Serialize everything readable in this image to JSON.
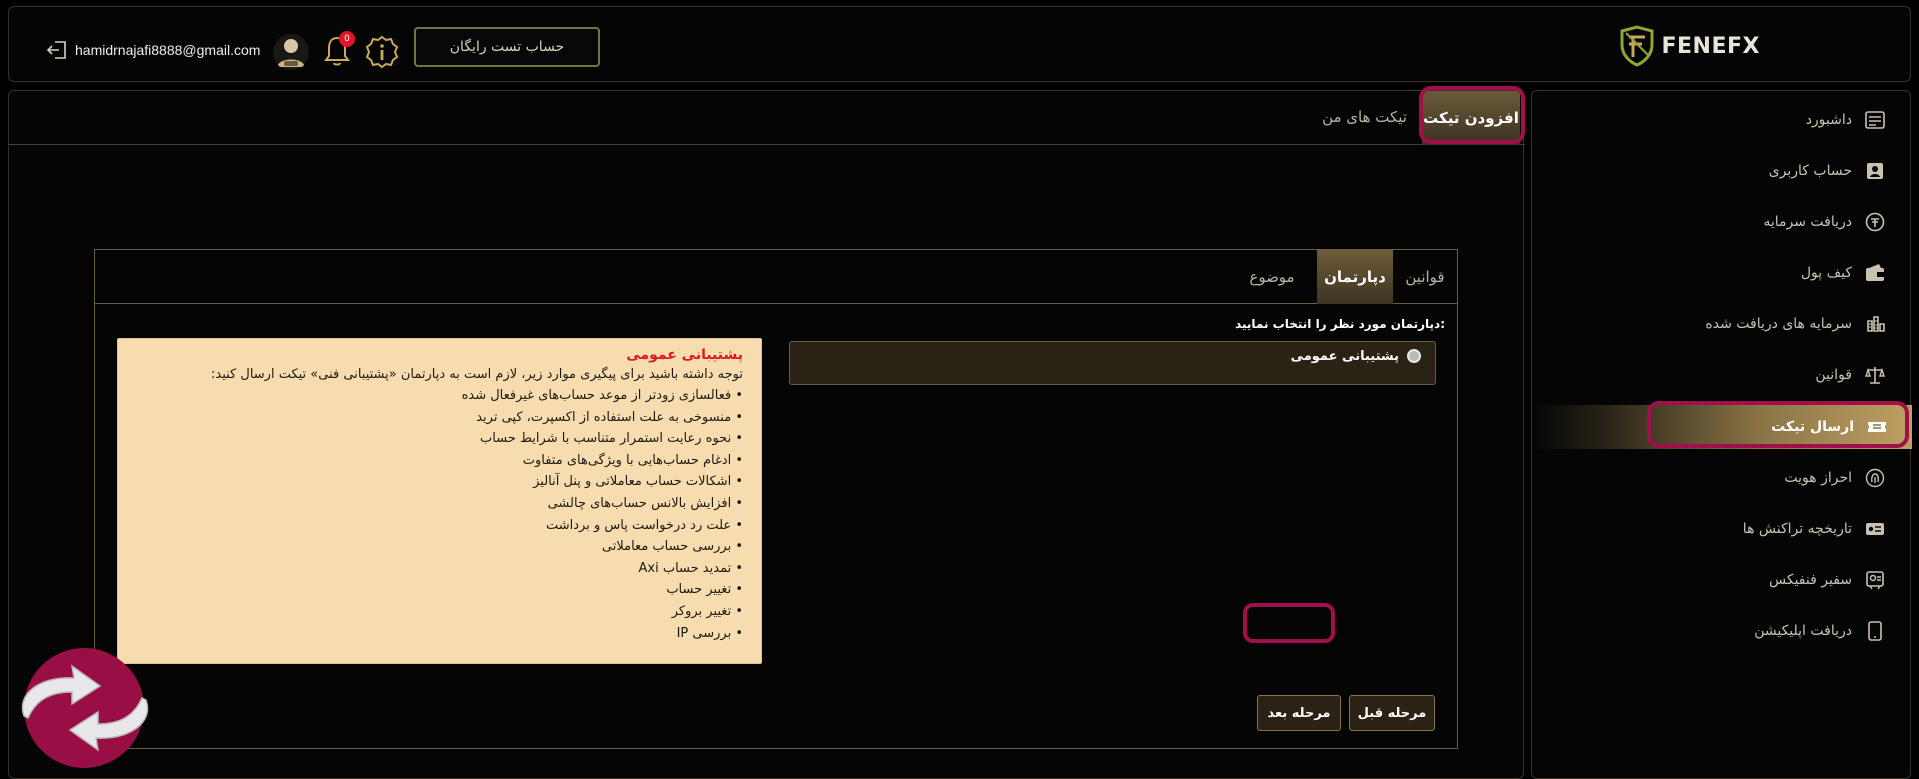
{
  "header": {
    "brand": "FENEFX",
    "trial_button": "حساب تست رایگان",
    "notification_count": "0",
    "email": "hamidrnajafi8888@gmail.com"
  },
  "sidebar": {
    "items": [
      {
        "label": "داشبورد",
        "icon": "dashboard-icon"
      },
      {
        "label": "حساب کاربری",
        "icon": "user-card-icon"
      },
      {
        "label": "دریافت سرمایه",
        "icon": "capital-icon"
      },
      {
        "label": "کیف پول",
        "icon": "wallet-icon"
      },
      {
        "label": "سرمایه های دریافت شده",
        "icon": "coins-icon"
      },
      {
        "label": "قوانین",
        "icon": "scales-icon"
      },
      {
        "label": "ارسال تیکت",
        "icon": "ticket-icon",
        "active": true
      },
      {
        "label": "احراز هویت",
        "icon": "fingerprint-icon"
      },
      {
        "label": "تاریخچه تراکنش ها",
        "icon": "transactions-icon"
      },
      {
        "label": "سفیر فنفیکس",
        "icon": "ambassador-icon"
      },
      {
        "label": "دریافت اپلیکیشن",
        "icon": "mobile-icon"
      }
    ]
  },
  "main": {
    "tabs": {
      "add_ticket": "افزودن تیکت",
      "my_tickets": "تیکت های من"
    },
    "steps": {
      "rules": "قوانین",
      "department": "دپارتمان",
      "subject": "موضوع"
    },
    "department": {
      "prompt": "دپارتمان مورد نظر را انتخاب نمایید:",
      "option": "پشتیبانی عمومی"
    },
    "notice": {
      "title": "پشتیبانی عمومی",
      "intro": "توجه داشته باشید برای پیگیری موارد زیر، لازم است به دپارتمان «پشتیبانی فنی» تیکت ارسال کنید:",
      "items": [
        "• فعالسازی زودتر از موعد حساب‌های غیرفعال شده",
        "• منسوخی به علت استفاده از اکسپرت، کپی ترید",
        "• نحوه رعایت استمرار متناسب با شرایط حساب",
        "• ادغام حساب‌هایی با ویژگی‌های متفاوت",
        "• اشکالات حساب معاملاتی و پنل آنالیز",
        "• افزایش بالانس حساب‌های چالشی",
        "• علت رد درخواست پاس و برداشت",
        "• بررسی حساب معاملاتی",
        "• تمدید حساب Axi",
        "• تغییر حساب",
        "• تغییر بروکر",
        "• بررسی IP"
      ]
    },
    "buttons": {
      "prev": "مرحله قبل",
      "next": "مرحله بعد"
    }
  },
  "colors": {
    "accent_gold": "#bfa064",
    "highlight_outline": "#a0104a",
    "notice_bg": "#f6dcae",
    "notice_title": "#e01626",
    "logo_green": "#8aa832"
  }
}
